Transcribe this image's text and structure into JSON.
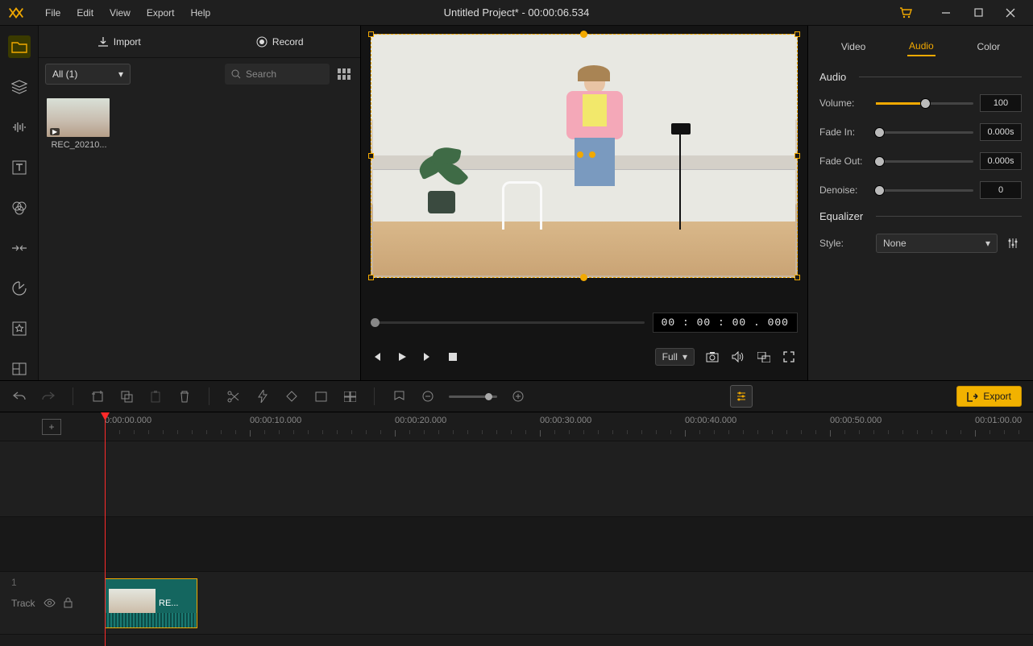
{
  "window": {
    "title": "Untitled Project* - 00:00:06.534"
  },
  "menu": [
    "File",
    "Edit",
    "View",
    "Export",
    "Help"
  ],
  "mediaPanel": {
    "importLabel": "Import",
    "recordLabel": "Record",
    "filterLabel": "All (1)",
    "searchPlaceholder": "Search",
    "clips": [
      {
        "name": "REC_20210..."
      }
    ]
  },
  "preview": {
    "timecode": "00 : 00 : 00 . 000",
    "screenMode": "Full"
  },
  "props": {
    "tabs": [
      "Video",
      "Audio",
      "Color"
    ],
    "activeTab": "Audio",
    "audioHeader": "Audio",
    "volumeLabel": "Volume:",
    "volumeValue": "100",
    "fadeInLabel": "Fade In:",
    "fadeInValue": "0.000s",
    "fadeOutLabel": "Fade Out:",
    "fadeOutValue": "0.000s",
    "denoiseLabel": "Denoise:",
    "denoiseValue": "0",
    "eqHeader": "Equalizer",
    "styleLabel": "Style:",
    "styleValue": "None"
  },
  "toolbar": {
    "exportLabel": "Export"
  },
  "timeline": {
    "addLabel": "+",
    "ticks": [
      "0:00:00.000",
      "00:00:10.000",
      "00:00:20.000",
      "00:00:30.000",
      "00:00:40.000",
      "00:00:50.000",
      "00:01:00.00"
    ],
    "trackNum": "1",
    "trackLabel": "Track",
    "clipName": "RE..."
  }
}
